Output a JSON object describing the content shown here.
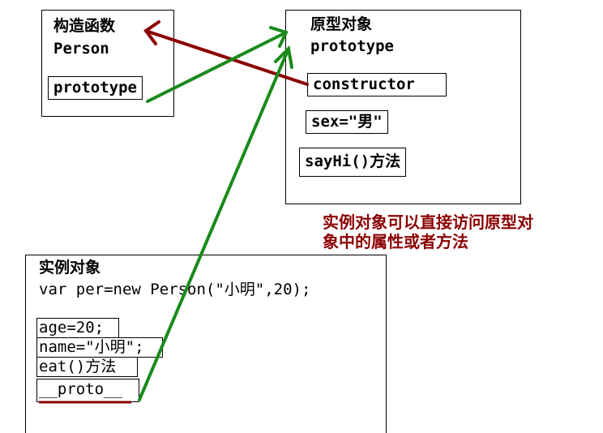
{
  "constructor_box": {
    "title": "构造函数",
    "name": "Person",
    "field": "prototype"
  },
  "prototype_box": {
    "title": "原型对象",
    "name": "prototype",
    "fields": [
      "constructor",
      "sex=\"男\"",
      "sayHi()方法"
    ]
  },
  "note": [
    "实例对象可以直接访问原型对",
    "象中的属性或者方法"
  ],
  "instance_box": {
    "title": "实例对象",
    "code": "var per=new Person(\"小明\",20);",
    "fields": [
      "age=20;",
      "name=\"小明\";",
      "eat()方法",
      "__proto__"
    ]
  },
  "colors": {
    "green_arrow": "#1a8a1a",
    "red_arrow": "#8b0000",
    "note": "#8b0000"
  }
}
